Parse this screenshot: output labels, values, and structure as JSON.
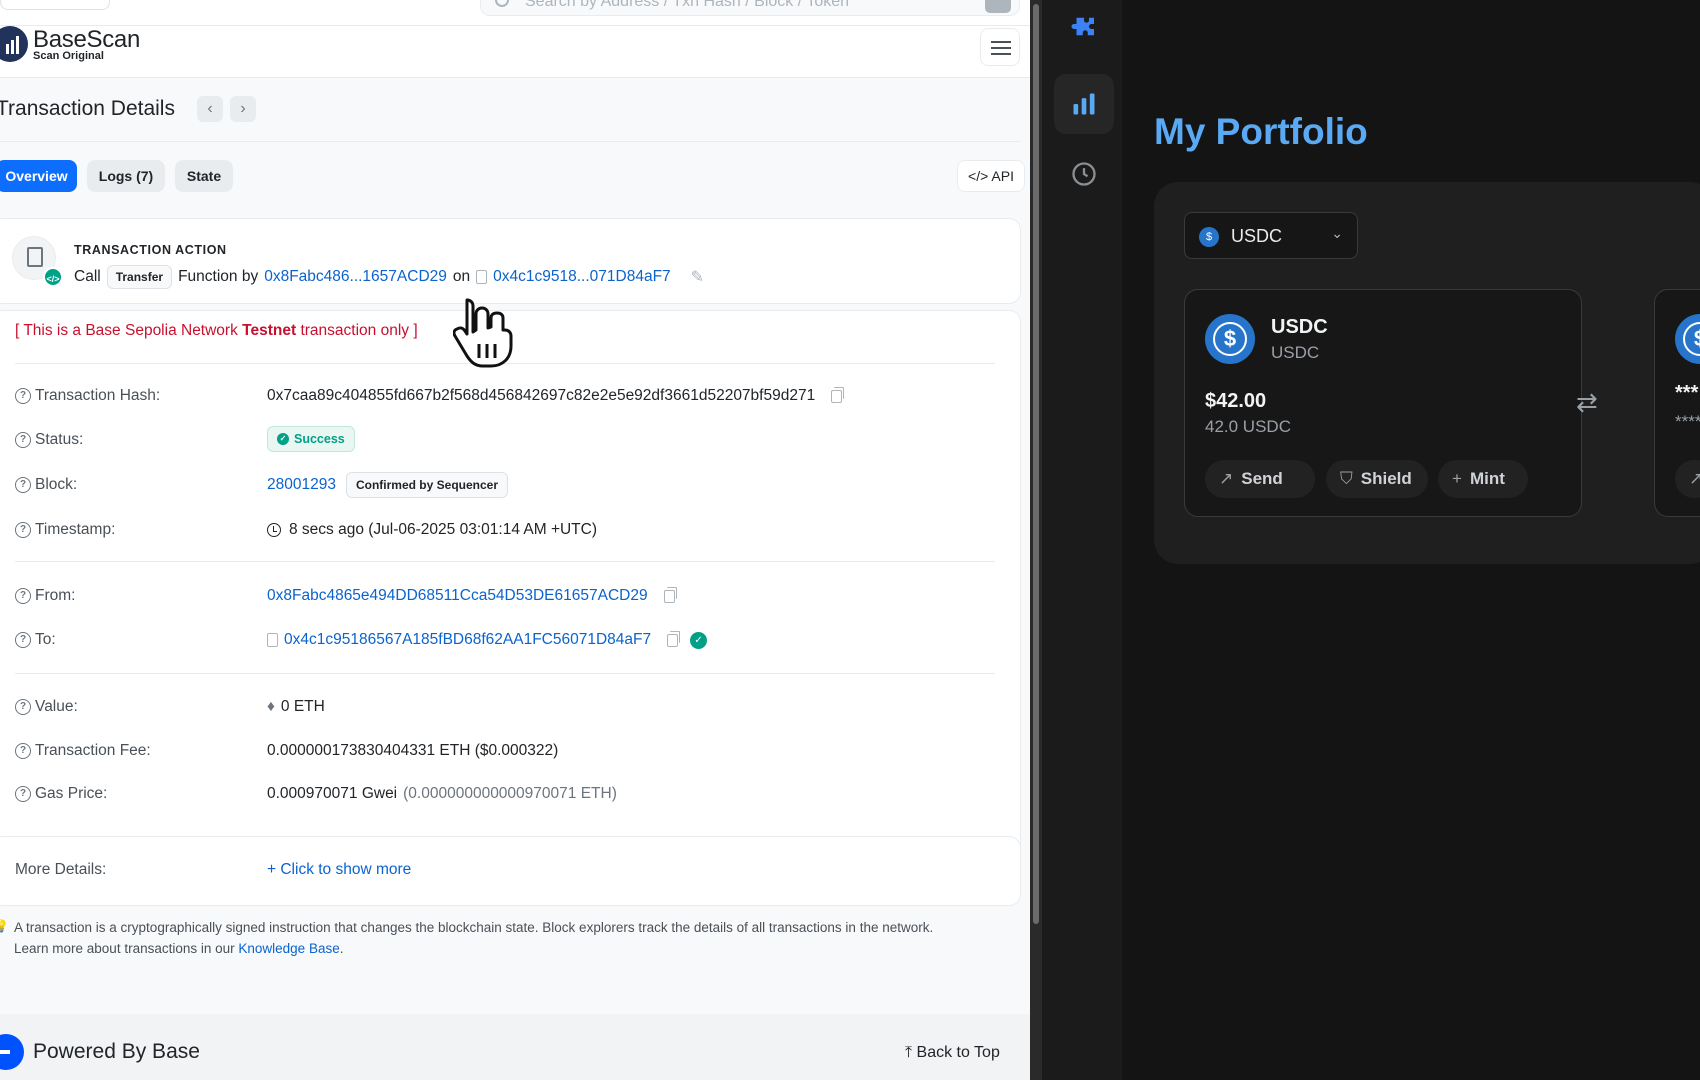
{
  "search": {
    "placeholder": "Search by Address / Txn Hash / Block / Token"
  },
  "brand": {
    "name": "BaseScan",
    "tagline": "Scan Original"
  },
  "page": {
    "title": "Transaction Details",
    "prev": "‹",
    "next": "›"
  },
  "tabs": [
    {
      "label": "Overview",
      "active": true
    },
    {
      "label": "Logs (7)",
      "active": false
    },
    {
      "label": "State",
      "active": false
    }
  ],
  "toolbar": {
    "api_label": "</> API",
    "options_label": "☷ ⌄"
  },
  "action": {
    "heading": "TRANSACTION ACTION",
    "call": "Call",
    "method_chip": "Transfer",
    "function_by": "Function by",
    "from_short": "0x8Fabc486...1657ACD29",
    "on": "on",
    "to_short": "0x4c1c9518...071D84aF7"
  },
  "testnet_notice": {
    "prefix": "[ This is a Base Sepolia Network ",
    "bold": "Testnet",
    "suffix": " transaction only ]"
  },
  "details": {
    "hash": {
      "label": "Transaction Hash:",
      "value": "0x7caa89c404855fd667b2f568d456842697c82e2e5e92df3661d52207bf59d271"
    },
    "status": {
      "label": "Status:",
      "value": "Success"
    },
    "block": {
      "label": "Block:",
      "value": "28001293",
      "chip": "Confirmed by Sequencer"
    },
    "timestamp": {
      "label": "Timestamp:",
      "value": "8 secs ago (Jul-06-2025 03:01:14 AM +UTC)"
    },
    "from": {
      "label": "From:",
      "value": "0x8Fabc4865e494DD68511Cca54D53DE61657ACD29"
    },
    "to": {
      "label": "To:",
      "value": "0x4c1c95186567A185fBD68f62AA1FC56071D84aF7"
    },
    "value": {
      "label": "Value:",
      "value": "0 ETH"
    },
    "fee": {
      "label": "Transaction Fee:",
      "value": "0.000000173830404331 ETH ($0.000322)"
    },
    "gas": {
      "label": "Gas Price:",
      "value": "0.000970071 Gwei",
      "sub": "(0.000000000000970071 ETH)"
    }
  },
  "more": {
    "label": "More Details:",
    "link": "+ Click to show more"
  },
  "footer": {
    "note": "A transaction is a cryptographically signed instruction that changes the blockchain state. Block explorers track the details of all transactions in the network.",
    "learn_prefix": "Learn more about transactions in our ",
    "learn_link": "Knowledge Base",
    "learn_suffix": "."
  },
  "bottom": {
    "powered": "Powered By Base",
    "back_to_top": "Back to Top"
  },
  "wallet": {
    "title": "My Portfolio",
    "token_select": "USDC",
    "card": {
      "name": "USDC",
      "symbol": "USDC",
      "usd": "$42.00",
      "amount": "42.0 USDC"
    },
    "actions": [
      "Send",
      "Shield",
      "Mint"
    ],
    "masked_primary": "***",
    "masked_secondary": "****",
    "accent": "#5aa9f5"
  }
}
